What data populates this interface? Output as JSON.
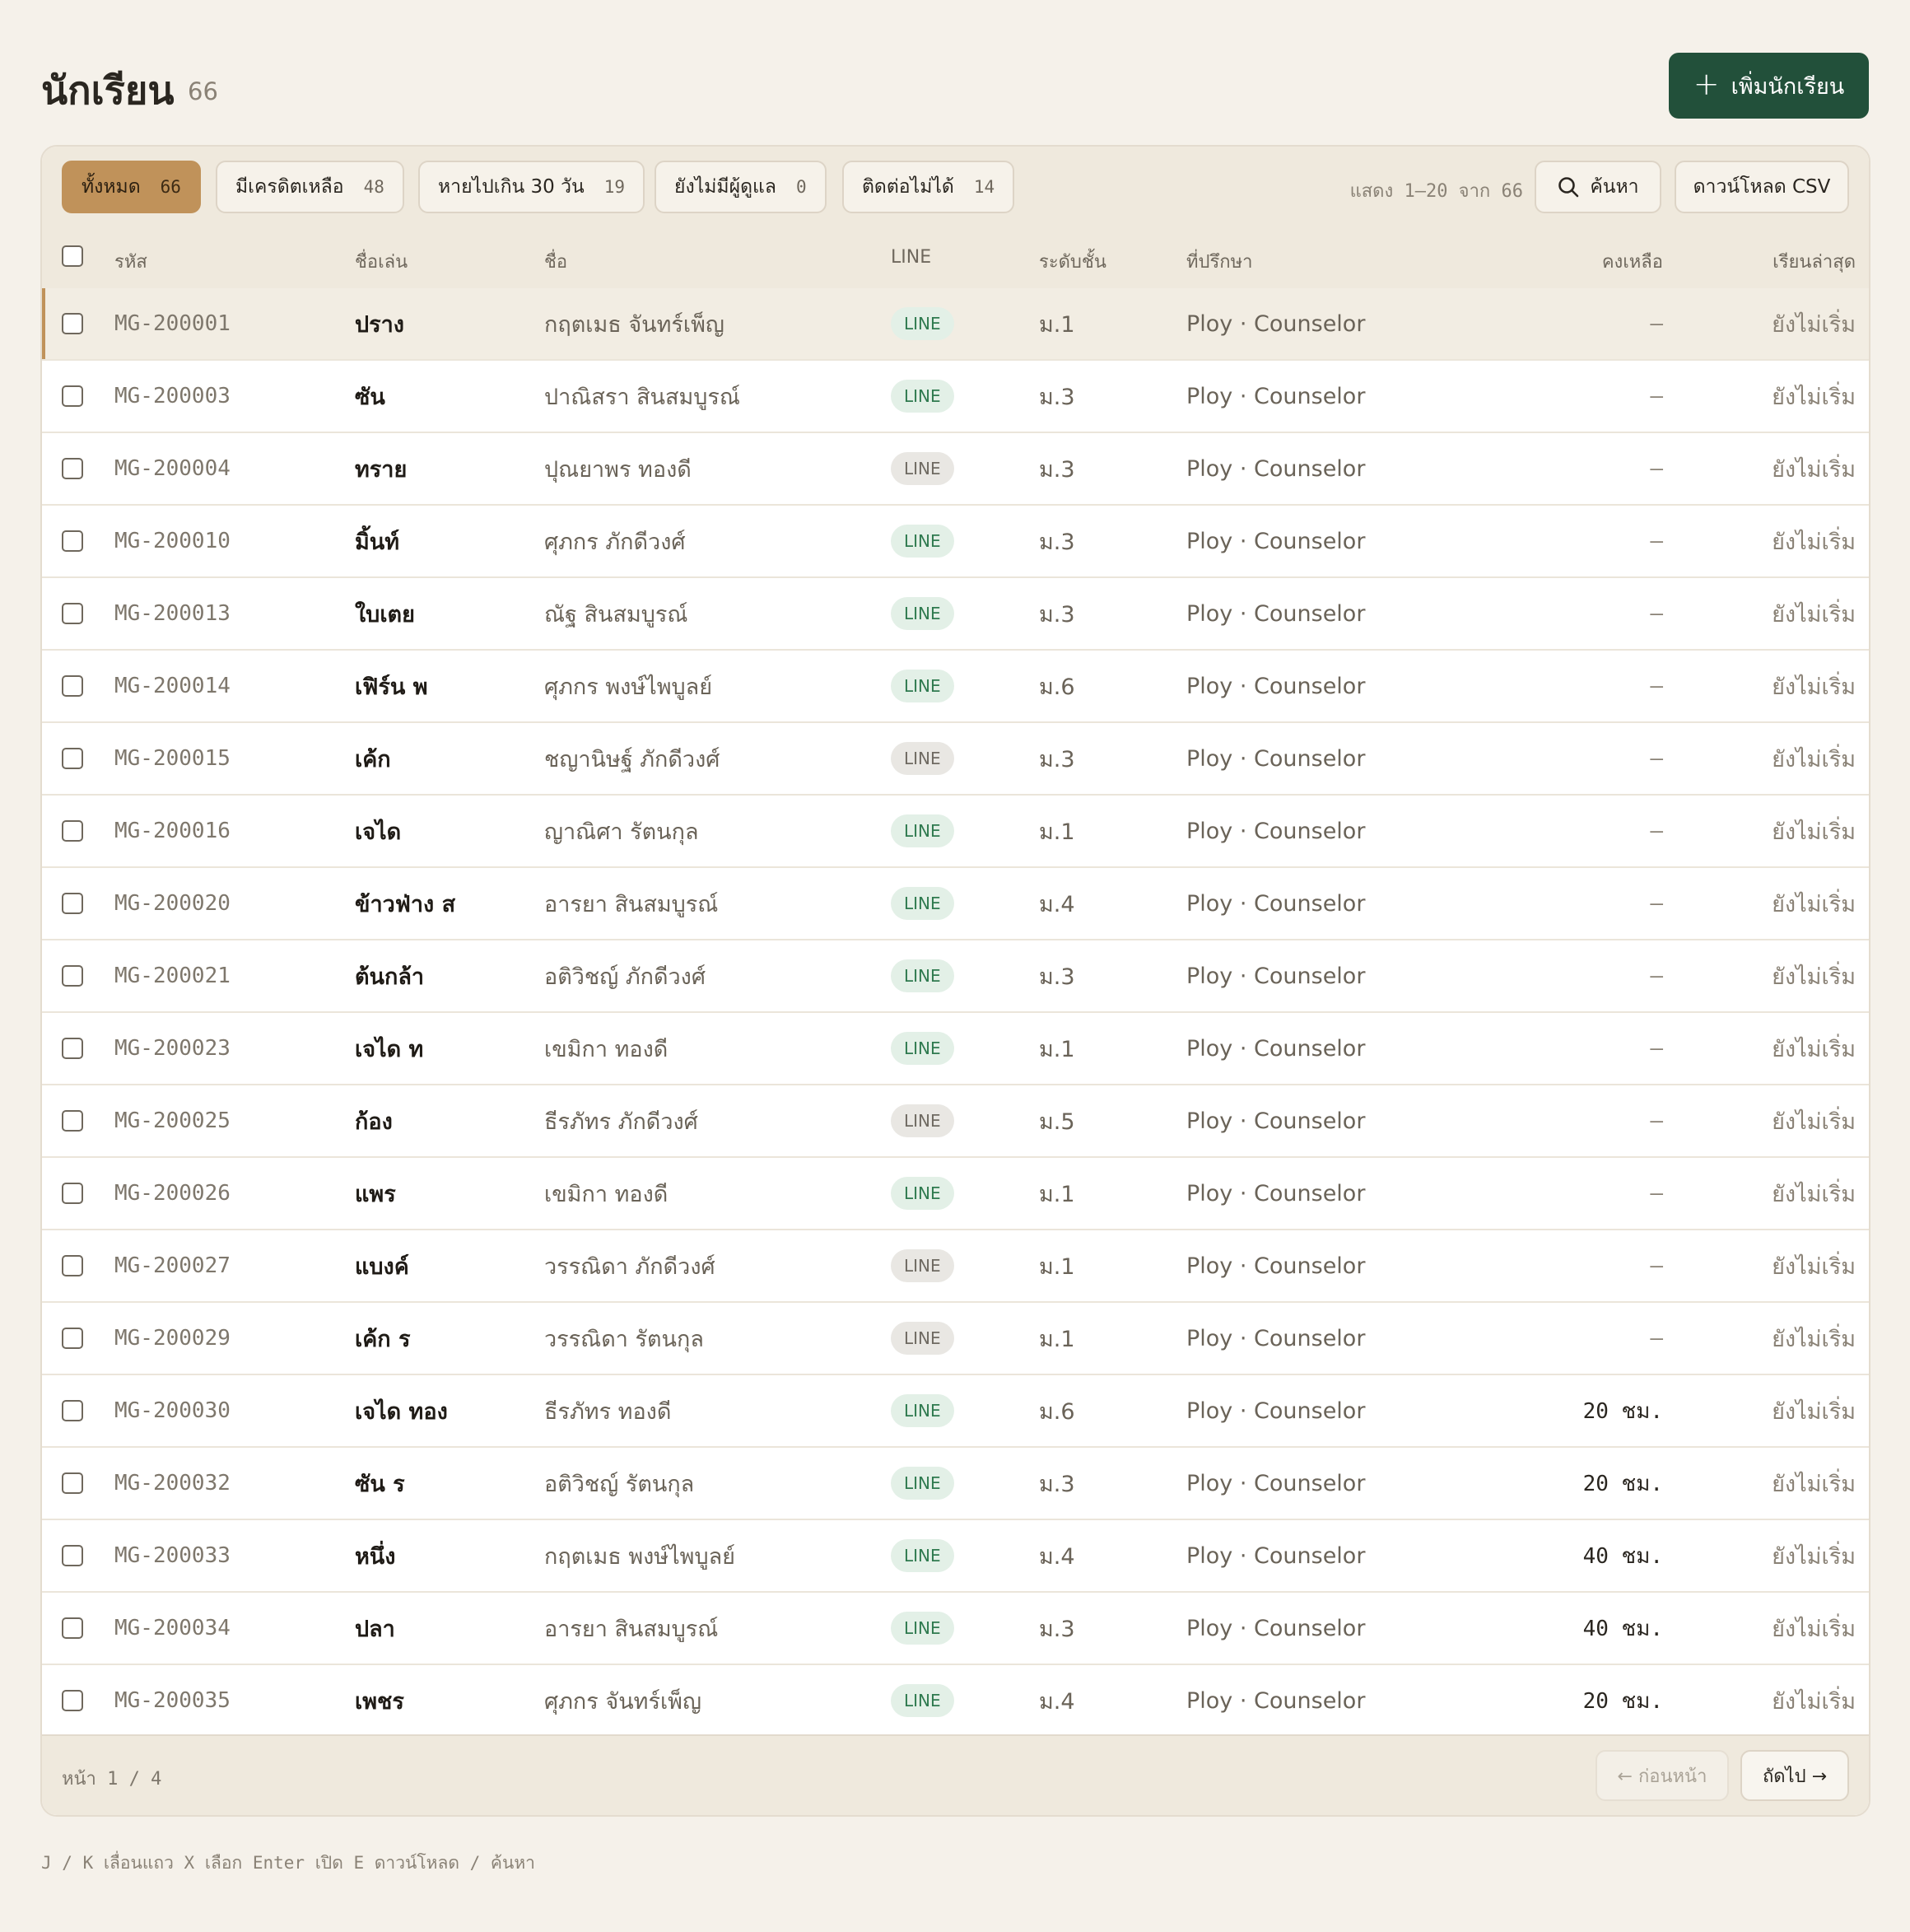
{
  "header": {
    "title": "นักเรียน",
    "count": "66",
    "add_button": "เพิ่มนักเรียน"
  },
  "filters": [
    {
      "label": "ทั้งหมด",
      "count": "66"
    },
    {
      "label": "มีเครดิตเหลือ",
      "count": "48"
    },
    {
      "label": "หายไปเกิน 30 วัน",
      "count": "19"
    },
    {
      "label": "ยังไม่มีผู้ดูแล",
      "count": "0"
    },
    {
      "label": "ติดต่อไม่ได้",
      "count": "14"
    }
  ],
  "toolbar": {
    "range": "แสดง 1–20 จาก 66",
    "search": "ค้นหา",
    "download": "ดาวน์โหลด CSV"
  },
  "columns": {
    "id": "รหัส",
    "nick": "ชื่อเล่น",
    "name": "ชื่อ",
    "line": "LINE",
    "grade": "ระดับชั้น",
    "advisor": "ที่ปรึกษา",
    "remaining": "คงเหลือ",
    "last": "เรียนล่าสุด"
  },
  "rows": [
    {
      "id": "MG-200001",
      "nick": "ปราง",
      "name": "กฤตเมธ จันทร์เพ็ญ",
      "line": "LINE",
      "line_on": true,
      "grade": "ม.1",
      "advisor": "Ploy · Counselor",
      "remaining": "—",
      "last": "ยังไม่เริ่ม"
    },
    {
      "id": "MG-200003",
      "nick": "ซัน",
      "name": "ปาณิสรา สินสมบูรณ์",
      "line": "LINE",
      "line_on": true,
      "grade": "ม.3",
      "advisor": "Ploy · Counselor",
      "remaining": "—",
      "last": "ยังไม่เริ่ม"
    },
    {
      "id": "MG-200004",
      "nick": "ทราย",
      "name": "ปุณยาพร ทองดี",
      "line": "LINE",
      "line_on": false,
      "grade": "ม.3",
      "advisor": "Ploy · Counselor",
      "remaining": "—",
      "last": "ยังไม่เริ่ม"
    },
    {
      "id": "MG-200010",
      "nick": "มิ้นท์",
      "name": "ศุภกร ภักดีวงศ์",
      "line": "LINE",
      "line_on": true,
      "grade": "ม.3",
      "advisor": "Ploy · Counselor",
      "remaining": "—",
      "last": "ยังไม่เริ่ม"
    },
    {
      "id": "MG-200013",
      "nick": "ใบเตย",
      "name": "ณัฐ สินสมบูรณ์",
      "line": "LINE",
      "line_on": true,
      "grade": "ม.3",
      "advisor": "Ploy · Counselor",
      "remaining": "—",
      "last": "ยังไม่เริ่ม"
    },
    {
      "id": "MG-200014",
      "nick": "เฟิร์น พ",
      "name": "ศุภกร พงษ์ไพบูลย์",
      "line": "LINE",
      "line_on": true,
      "grade": "ม.6",
      "advisor": "Ploy · Counselor",
      "remaining": "—",
      "last": "ยังไม่เริ่ม"
    },
    {
      "id": "MG-200015",
      "nick": "เค้ก",
      "name": "ชญานิษฐ์ ภักดีวงศ์",
      "line": "LINE",
      "line_on": false,
      "grade": "ม.3",
      "advisor": "Ploy · Counselor",
      "remaining": "—",
      "last": "ยังไม่เริ่ม"
    },
    {
      "id": "MG-200016",
      "nick": "เจได",
      "name": "ญาณิศา รัตนกุล",
      "line": "LINE",
      "line_on": true,
      "grade": "ม.1",
      "advisor": "Ploy · Counselor",
      "remaining": "—",
      "last": "ยังไม่เริ่ม"
    },
    {
      "id": "MG-200020",
      "nick": "ข้าวฟ่าง ส",
      "name": "อารยา สินสมบูรณ์",
      "line": "LINE",
      "line_on": true,
      "grade": "ม.4",
      "advisor": "Ploy · Counselor",
      "remaining": "—",
      "last": "ยังไม่เริ่ม"
    },
    {
      "id": "MG-200021",
      "nick": "ต้นกล้า",
      "name": "อติวิชญ์ ภักดีวงศ์",
      "line": "LINE",
      "line_on": true,
      "grade": "ม.3",
      "advisor": "Ploy · Counselor",
      "remaining": "—",
      "last": "ยังไม่เริ่ม"
    },
    {
      "id": "MG-200023",
      "nick": "เจได ท",
      "name": "เขมิกา ทองดี",
      "line": "LINE",
      "line_on": true,
      "grade": "ม.1",
      "advisor": "Ploy · Counselor",
      "remaining": "—",
      "last": "ยังไม่เริ่ม"
    },
    {
      "id": "MG-200025",
      "nick": "ก้อง",
      "name": "ธีรภัทร ภักดีวงศ์",
      "line": "LINE",
      "line_on": false,
      "grade": "ม.5",
      "advisor": "Ploy · Counselor",
      "remaining": "—",
      "last": "ยังไม่เริ่ม"
    },
    {
      "id": "MG-200026",
      "nick": "แพร",
      "name": "เขมิกา ทองดี",
      "line": "LINE",
      "line_on": true,
      "grade": "ม.1",
      "advisor": "Ploy · Counselor",
      "remaining": "—",
      "last": "ยังไม่เริ่ม"
    },
    {
      "id": "MG-200027",
      "nick": "แบงค์",
      "name": "วรรณิดา ภักดีวงศ์",
      "line": "LINE",
      "line_on": false,
      "grade": "ม.1",
      "advisor": "Ploy · Counselor",
      "remaining": "—",
      "last": "ยังไม่เริ่ม"
    },
    {
      "id": "MG-200029",
      "nick": "เค้ก ร",
      "name": "วรรณิดา รัตนกุล",
      "line": "LINE",
      "line_on": false,
      "grade": "ม.1",
      "advisor": "Ploy · Counselor",
      "remaining": "—",
      "last": "ยังไม่เริ่ม"
    },
    {
      "id": "MG-200030",
      "nick": "เจได ทอง",
      "name": "ธีรภัทร ทองดี",
      "line": "LINE",
      "line_on": true,
      "grade": "ม.6",
      "advisor": "Ploy · Counselor",
      "remaining": "20 ชม.",
      "last": "ยังไม่เริ่ม"
    },
    {
      "id": "MG-200032",
      "nick": "ซัน ร",
      "name": "อติวิชญ์ รัตนกุล",
      "line": "LINE",
      "line_on": true,
      "grade": "ม.3",
      "advisor": "Ploy · Counselor",
      "remaining": "20 ชม.",
      "last": "ยังไม่เริ่ม"
    },
    {
      "id": "MG-200033",
      "nick": "หนึ่ง",
      "name": "กฤตเมธ พงษ์ไพบูลย์",
      "line": "LINE",
      "line_on": true,
      "grade": "ม.4",
      "advisor": "Ploy · Counselor",
      "remaining": "40 ชม.",
      "last": "ยังไม่เริ่ม"
    },
    {
      "id": "MG-200034",
      "nick": "ปลา",
      "name": "อารยา สินสมบูรณ์",
      "line": "LINE",
      "line_on": true,
      "grade": "ม.3",
      "advisor": "Ploy · Counselor",
      "remaining": "40 ชม.",
      "last": "ยังไม่เริ่ม"
    },
    {
      "id": "MG-200035",
      "nick": "เพชร",
      "name": "ศุภกร จันทร์เพ็ญ",
      "line": "LINE",
      "line_on": true,
      "grade": "ม.4",
      "advisor": "Ploy · Counselor",
      "remaining": "20 ชม.",
      "last": "ยังไม่เริ่ม"
    }
  ],
  "footer": {
    "page": "หน้า 1 / 4",
    "prev": "← ก่อนหน้า",
    "next": "ถัดไป →"
  },
  "shortcuts": "J / K เลื่อนแถว  X เลือก  Enter เปิด  E ดาวน์โหลด  / ค้นหา"
}
